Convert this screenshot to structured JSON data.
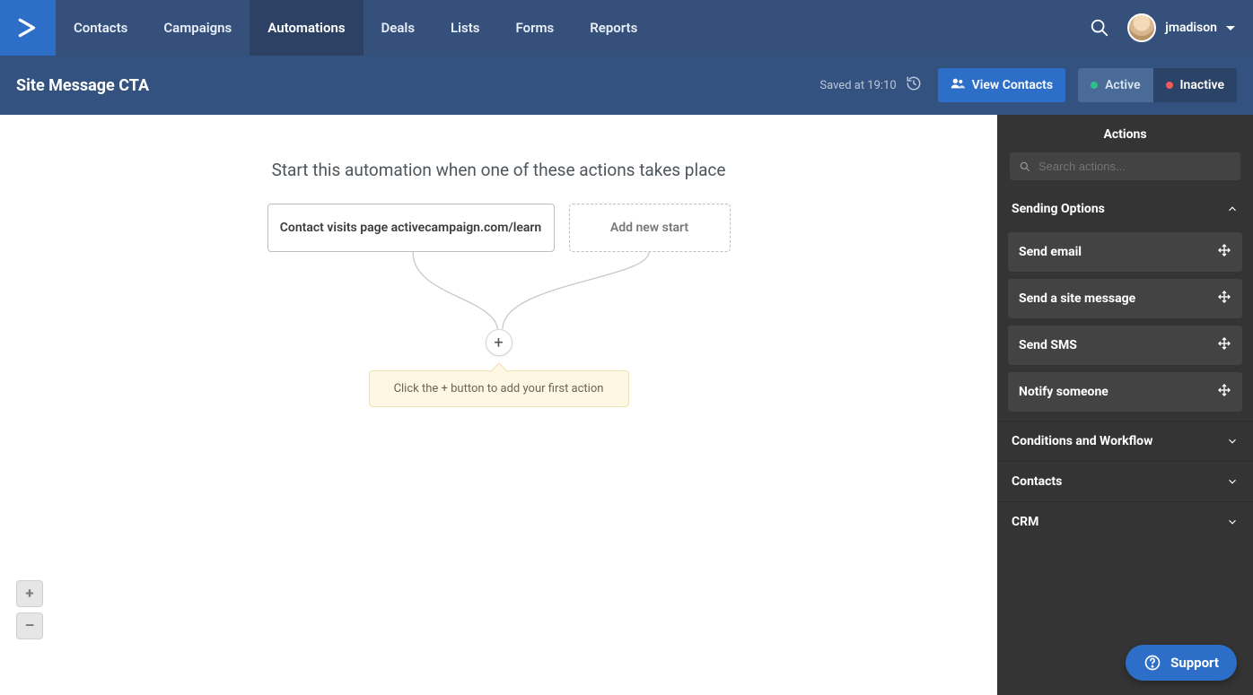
{
  "nav": {
    "items": [
      "Contacts",
      "Campaigns",
      "Automations",
      "Deals",
      "Lists",
      "Forms",
      "Reports"
    ],
    "active_index": 2
  },
  "user": {
    "name": "jmadison"
  },
  "subheader": {
    "title": "Site Message CTA",
    "saved_text": "Saved at 19:10",
    "view_contacts_label": "View Contacts",
    "active_label": "Active",
    "inactive_label": "Inactive"
  },
  "flow": {
    "prompt": "Start this automation when one of these actions takes place",
    "start_trigger": "Contact visits page activecampaign.com/learn",
    "add_start_label": "Add new start",
    "hint": "Click the + button to add your first action",
    "plus_symbol": "+"
  },
  "zoom": {
    "in": "+",
    "out": "–"
  },
  "sidebar": {
    "title": "Actions",
    "search_placeholder": "Search actions...",
    "sections": [
      {
        "label": "Sending Options",
        "expanded": true,
        "items": [
          "Send email",
          "Send a site message",
          "Send SMS",
          "Notify someone"
        ]
      },
      {
        "label": "Conditions and Workflow",
        "expanded": false
      },
      {
        "label": "Contacts",
        "expanded": false
      },
      {
        "label": "CRM",
        "expanded": false
      }
    ]
  },
  "support": {
    "label": "Support"
  }
}
